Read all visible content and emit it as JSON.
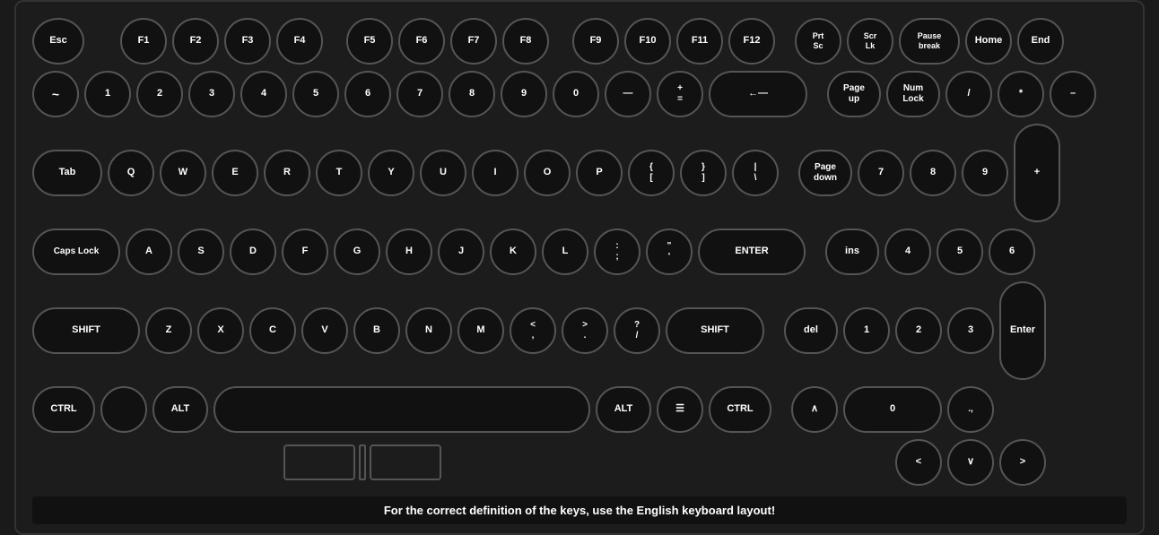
{
  "keyboard": {
    "rows": [
      {
        "id": "function-row",
        "keys": [
          {
            "id": "esc",
            "label": "Esc",
            "class": "esc"
          },
          {
            "id": "gap1",
            "label": "",
            "class": "gap"
          },
          {
            "id": "f1",
            "label": "F1",
            "class": ""
          },
          {
            "id": "f2",
            "label": "F2",
            "class": ""
          },
          {
            "id": "f3",
            "label": "F3",
            "class": ""
          },
          {
            "id": "f4",
            "label": "F4",
            "class": ""
          },
          {
            "id": "gap2",
            "label": "",
            "class": "gap"
          },
          {
            "id": "f5",
            "label": "F5",
            "class": ""
          },
          {
            "id": "f6",
            "label": "F6",
            "class": ""
          },
          {
            "id": "f7",
            "label": "F7",
            "class": ""
          },
          {
            "id": "f8",
            "label": "F8",
            "class": ""
          },
          {
            "id": "gap3",
            "label": "",
            "class": "gap"
          },
          {
            "id": "f9",
            "label": "F9",
            "class": ""
          },
          {
            "id": "f10",
            "label": "F10",
            "class": ""
          },
          {
            "id": "f11",
            "label": "F11",
            "class": ""
          },
          {
            "id": "f12",
            "label": "F12",
            "class": ""
          }
        ]
      }
    ],
    "bottom_bar": "For the correct definition of the keys, use the English keyboard layout!"
  }
}
